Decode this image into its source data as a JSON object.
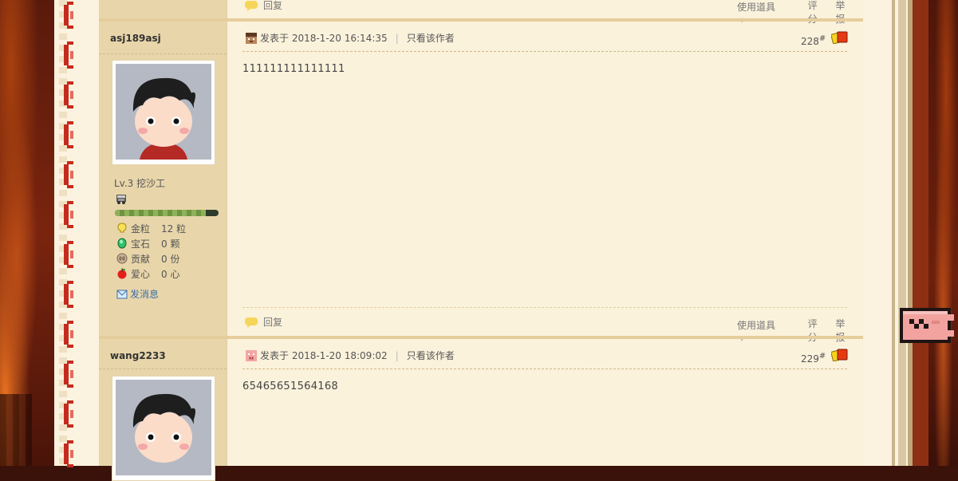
{
  "posts": [
    {
      "author": "asj189asj",
      "level": "Lv.3 挖沙工",
      "exp_fraction": 0.88,
      "stats": [
        {
          "icon": "gold-nugget-icon",
          "label": "金粒",
          "value": "12 粒"
        },
        {
          "icon": "emerald-icon",
          "label": "宝石",
          "value": "0 颗"
        },
        {
          "icon": "contribution-icon",
          "label": "贡献",
          "value": "0 份"
        },
        {
          "icon": "apple-heart-icon",
          "label": "爱心",
          "value": "0 心"
        }
      ],
      "send_message": "发消息",
      "posted_at": "发表于 2018-1-20 16:14:35",
      "only_author": "只看该作者",
      "floor": "228",
      "floor_mark": "#",
      "content": "111111111111111",
      "reply": "回复",
      "use_item": "使用道具",
      "rate": "评分",
      "report": "举报"
    },
    {
      "author": "wang2233",
      "posted_at": "发表于 2018-1-20 18:09:02",
      "only_author": "只看该作者",
      "floor": "229",
      "floor_mark": "#",
      "content": "65465651564168"
    }
  ],
  "top_partial": {
    "reply": "回复",
    "use_item": "使用道具",
    "rate": "评分",
    "report": "举报"
  },
  "colors": {
    "sidebar": "#e8d6aa",
    "content": "#fbf2dc",
    "separator": "#e6cd9c",
    "chain": "#c42b1e",
    "flag": "#f2a3a0"
  }
}
